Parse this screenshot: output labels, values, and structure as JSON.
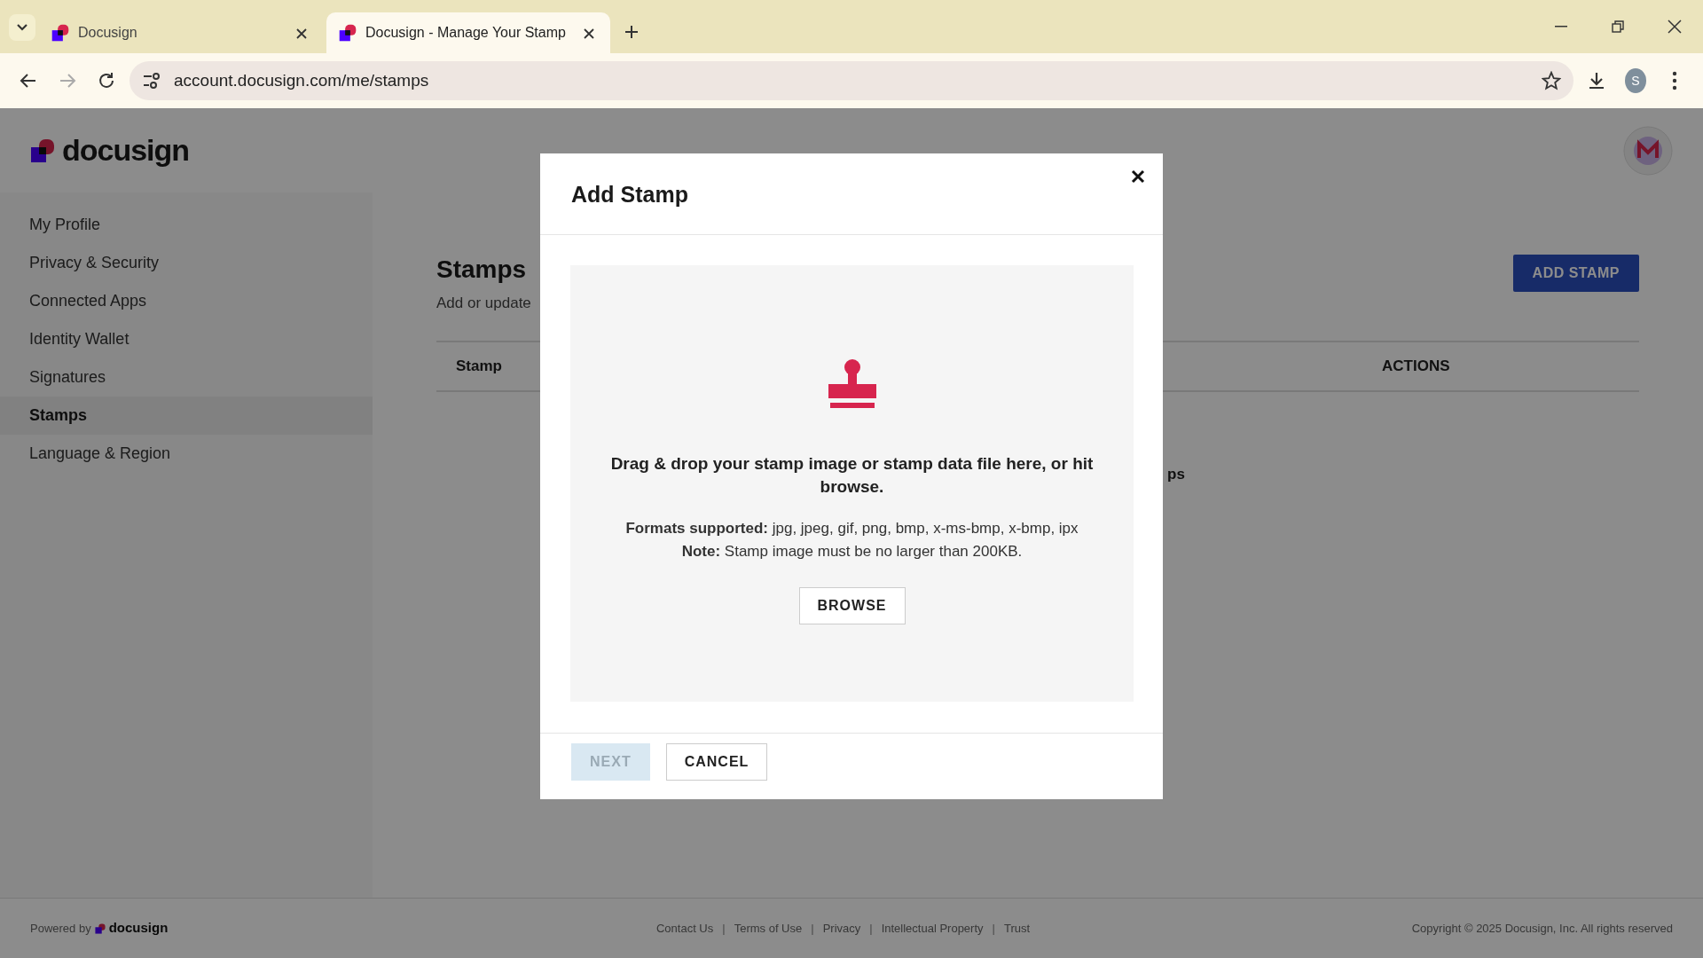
{
  "browser": {
    "tabs": [
      {
        "title": "Docusign",
        "selected": false
      },
      {
        "title": "Docusign - Manage Your Stamp",
        "selected": true
      }
    ],
    "address": "account.docusign.com/me/stamps",
    "profile_initial": "S"
  },
  "brand": {
    "name": "docusign"
  },
  "sidebar": {
    "items": [
      {
        "label": "My Profile",
        "selected": false
      },
      {
        "label": "Privacy & Security",
        "selected": false
      },
      {
        "label": "Connected Apps",
        "selected": false
      },
      {
        "label": "Identity Wallet",
        "selected": false
      },
      {
        "label": "Signatures",
        "selected": false
      },
      {
        "label": "Stamps",
        "selected": true
      },
      {
        "label": "Language & Region",
        "selected": false
      }
    ]
  },
  "content": {
    "title": "Stamps",
    "subtitle": "Add or update",
    "add_button": "ADD STAMP",
    "table": {
      "columns": [
        "Stamp",
        "ACTIONS"
      ]
    },
    "empty_fragment": "ps"
  },
  "modal": {
    "title": "Add Stamp",
    "dropzone_text": "Drag & drop your stamp image or stamp data file here, or hit browse.",
    "formats": "**Formats supported:** jpg, jpeg, gif, png, bmp, x-ms-bmp, x-bmp, ipx",
    "note": "**Note:** Stamp image must be no larger than 200KB.",
    "browse_button": "BROWSE",
    "buttons": [
      {
        "label": "NEXT",
        "disabled": true
      },
      {
        "label": "CANCEL",
        "disabled": false
      }
    ]
  },
  "footer": {
    "powered_by": "Powered by",
    "brand": "docusign",
    "links": [
      "Contact Us",
      "Terms of Use",
      "Privacy",
      "Intellectual Property",
      "Trust"
    ],
    "link_separator": "|",
    "copyright": "Copyright © 2025 Docusign, Inc. All rights reserved"
  }
}
